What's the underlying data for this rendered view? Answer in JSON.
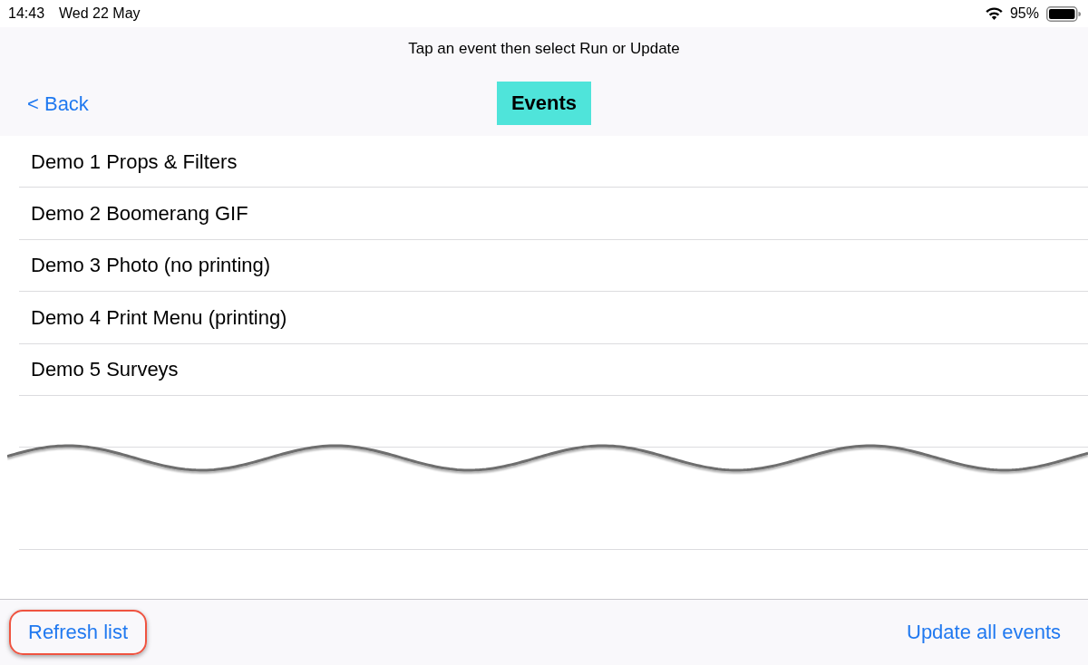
{
  "status_bar": {
    "time": "14:43",
    "date": "Wed 22 May",
    "battery_percent": "95%"
  },
  "header": {
    "hint": "Tap an event then select Run or Update",
    "back": "< Back",
    "title": {
      "text": "Events",
      "highlighted": true
    }
  },
  "events": [
    {
      "name": "Demo 1 Props & Filters",
      "selected": false
    },
    {
      "name": "Demo 2 Boomerang GIF",
      "selected": false
    },
    {
      "name": "Demo 3 Photo (no printing)",
      "selected": false
    },
    {
      "name": "Demo 4 Print Menu (printing)",
      "selected": false
    },
    {
      "name": "Demo 5 Surveys",
      "selected": false
    }
  ],
  "toolbar": {
    "buttons": [
      {
        "label": "Refresh list",
        "highlighted": true
      },
      {
        "label": "Update all events",
        "highlighted": false
      }
    ]
  }
}
